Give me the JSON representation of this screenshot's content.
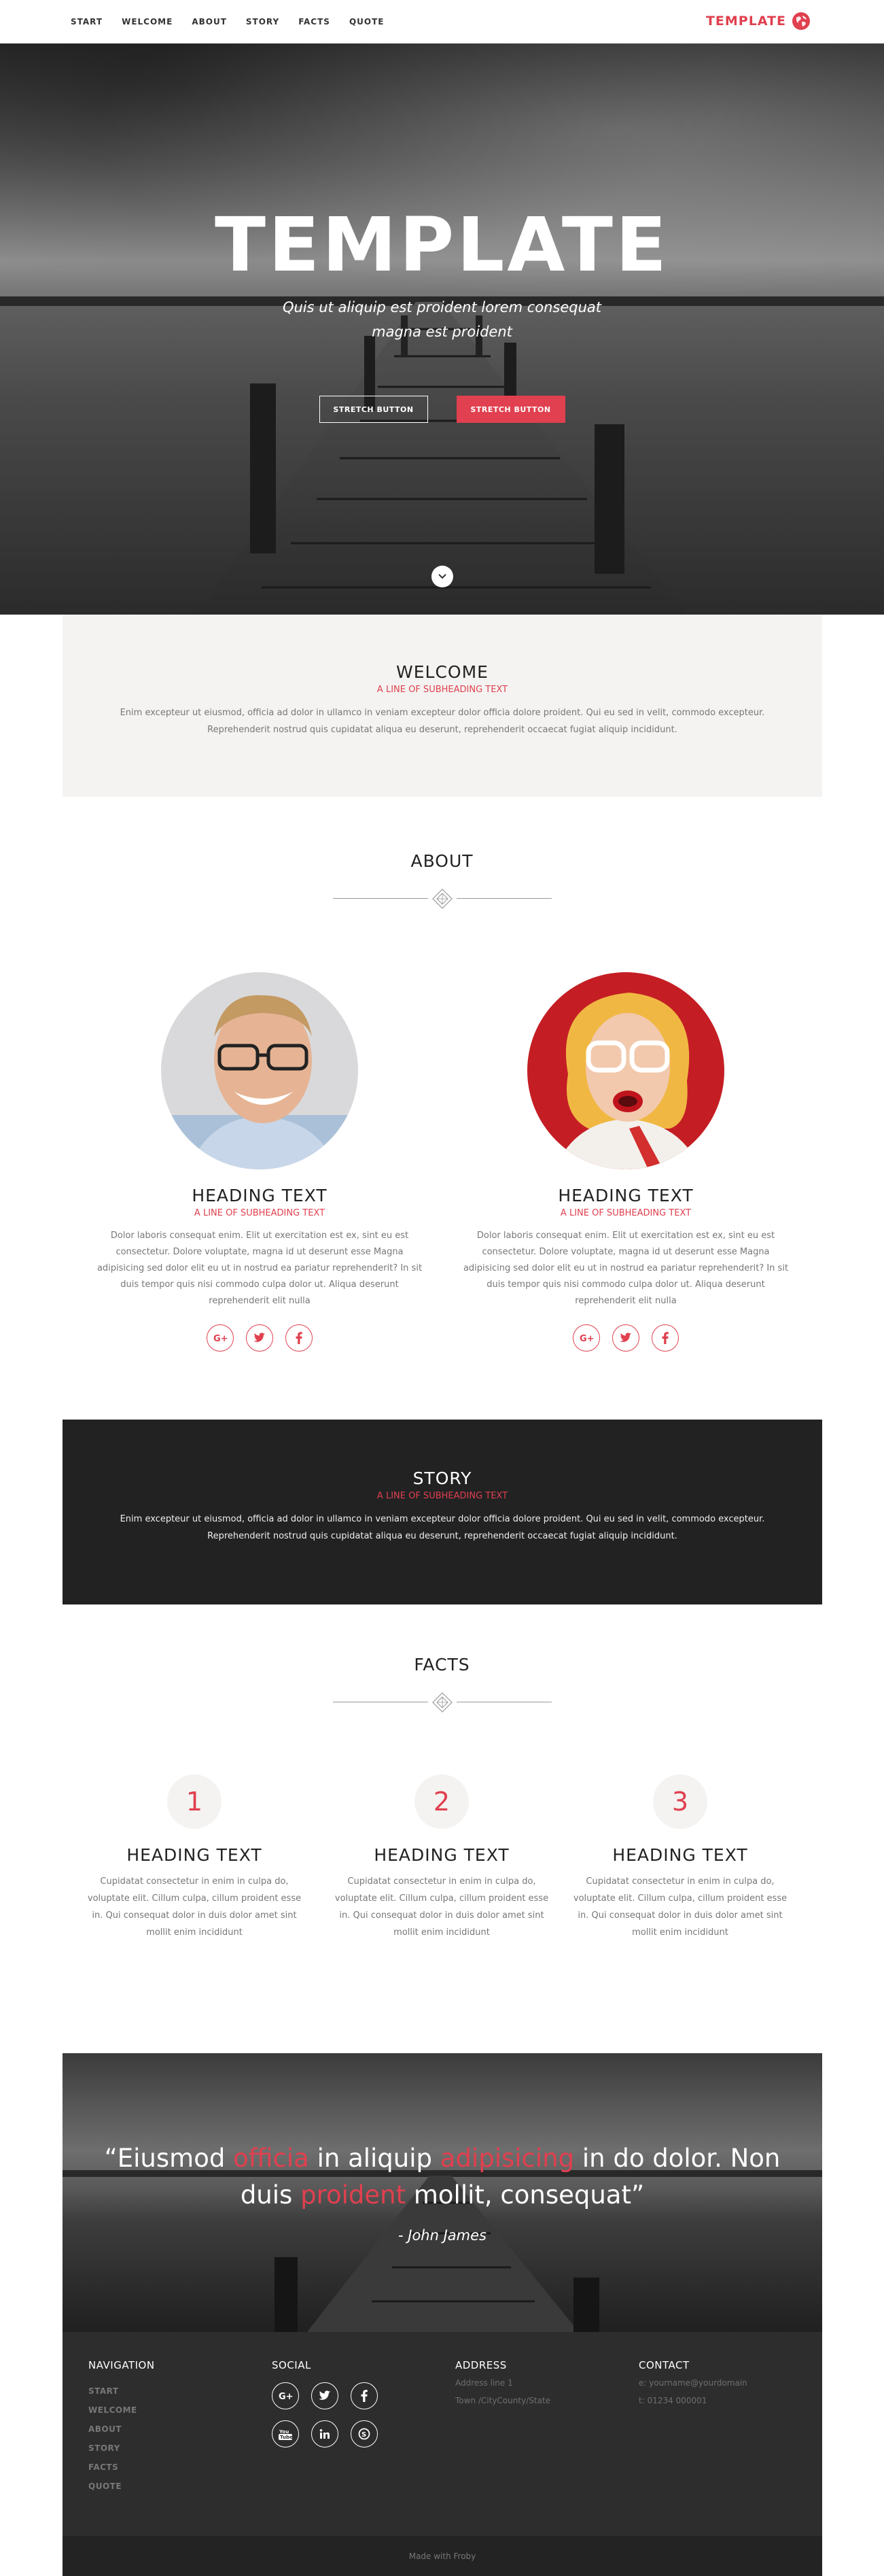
{
  "nav": {
    "items": [
      "START",
      "WELCOME",
      "ABOUT",
      "STORY",
      "FACTS",
      "QUOTE"
    ],
    "brand": "TEMPLATE"
  },
  "hero": {
    "title": "TEMPLATE",
    "subtitle": "Quis ut aliquip est proident lorem consequat magna est proident",
    "button_outline": "STRETCH BUTTON",
    "button_red": "STRETCH BUTTON"
  },
  "welcome": {
    "title": "WELCOME",
    "subheading": "A LINE OF SUBHEADING TEXT",
    "text": "Enim excepteur ut eiusmod, officia ad dolor in ullamco in veniam excepteur dolor officia dolore proident. Qui eu sed in velit, commodo excepteur. Reprehenderit nostrud quis cupidatat aliqua eu deserunt, reprehenderit occaecat fugiat aliquip incididunt."
  },
  "about": {
    "title": "ABOUT",
    "people": [
      {
        "heading": "HEADING TEXT",
        "subheading": "A LINE OF SUBHEADING TEXT",
        "text": "Dolor laboris consequat enim. Elit ut exercitation est ex, sint eu est consectetur. Dolore voluptate, magna id ut deserunt esse Magna adipisicing sed dolor elit eu ut in nostrud ea pariatur reprehenderit? In sit duis tempor quis nisi commodo culpa dolor ut. Aliqua deserunt reprehenderit elit nulla"
      },
      {
        "heading": "HEADING TEXT",
        "subheading": "A LINE OF SUBHEADING TEXT",
        "text": "Dolor laboris consequat enim. Elit ut exercitation est ex, sint eu est consectetur. Dolore voluptate, magna id ut deserunt esse Magna adipisicing sed dolor elit eu ut in nostrud ea pariatur reprehenderit? In sit duis tempor quis nisi commodo culpa dolor ut. Aliqua deserunt reprehenderit elit nulla"
      }
    ],
    "social_icons": [
      "google-plus-icon",
      "twitter-icon",
      "facebook-icon"
    ]
  },
  "story": {
    "title": "STORY",
    "subheading": "A LINE OF SUBHEADING TEXT",
    "text": "Enim excepteur ut eiusmod, officia ad dolor in ullamco in veniam excepteur dolor officia dolore proident. Qui eu sed in velit, commodo excepteur. Reprehenderit nostrud quis cupidatat aliqua eu deserunt, reprehenderit occaecat fugiat aliquip incididunt."
  },
  "facts": {
    "title": "FACTS",
    "items": [
      {
        "number": "1",
        "heading": "HEADING TEXT",
        "text": "Cupidatat consectetur in enim in culpa do, voluptate elit. Cillum culpa, cillum proident esse in. Qui consequat dolor in duis dolor amet sint mollit enim incididunt"
      },
      {
        "number": "2",
        "heading": "HEADING TEXT",
        "text": "Cupidatat consectetur in enim in culpa do, voluptate elit. Cillum culpa, cillum proident esse in. Qui consequat dolor in duis dolor amet sint mollit enim incididunt"
      },
      {
        "number": "3",
        "heading": "HEADING TEXT",
        "text": "Cupidatat consectetur in enim in culpa do, voluptate elit. Cillum culpa, cillum proident esse in. Qui consequat dolor in duis dolor amet sint mollit enim incididunt"
      }
    ]
  },
  "quote": {
    "parts": [
      "“Eiusmod ",
      "officia",
      " in aliquip ",
      "adipisicing",
      " in do dolor. Non duis ",
      "proident",
      " mollit, consequat”"
    ],
    "author": "- John James"
  },
  "footer": {
    "navigation_title": "NAVIGATION",
    "navigation_links": [
      "START",
      "WELCOME",
      "ABOUT",
      "STORY",
      "FACTS",
      "QUOTE"
    ],
    "social_title": "SOCIAL",
    "social_icons": [
      "google-plus-icon",
      "twitter-icon",
      "facebook-icon",
      "youtube-icon",
      "linkedin-icon",
      "skype-icon"
    ],
    "address_title": "ADDRESS",
    "address_lines": [
      "Address line 1",
      "Town /CityCounty/State"
    ],
    "contact_title": "CONTACT",
    "contact_lines": [
      "e: yourname@yourdomain",
      "t: 01234 000001"
    ],
    "made_with": "Made with Froby"
  },
  "colors": {
    "accent": "#e0404f",
    "dark": "#222223",
    "light_bg": "#f4f3f1"
  }
}
